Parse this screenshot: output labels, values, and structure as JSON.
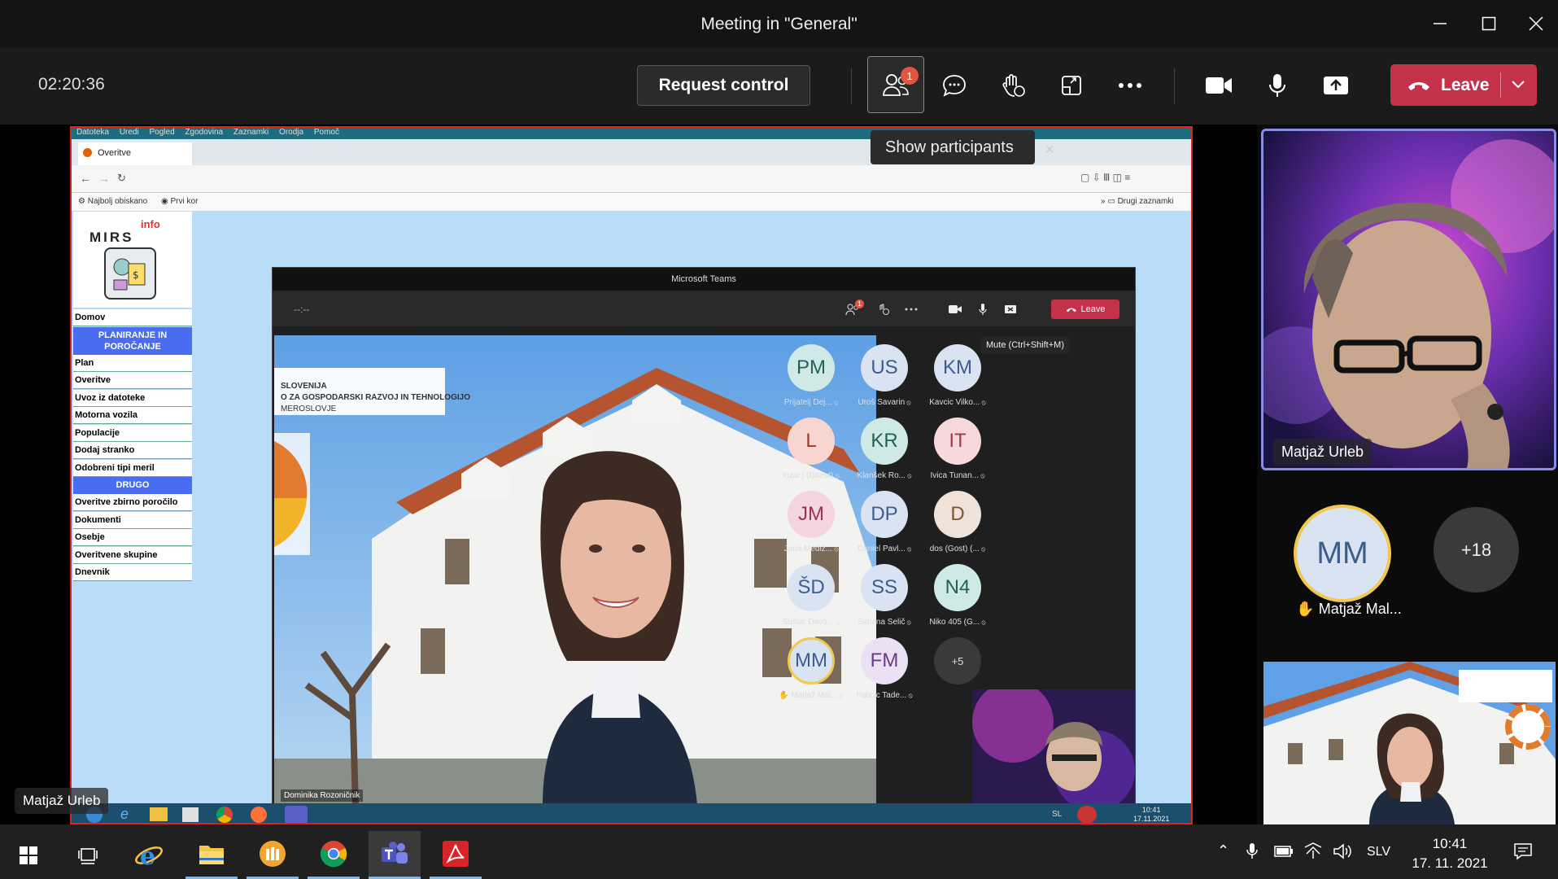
{
  "window": {
    "title": "Meeting in \"General\""
  },
  "toolbar": {
    "timer": "02:20:36",
    "request_control": "Request control",
    "participants_badge": "1",
    "leave_label": "Leave",
    "tooltip": "Show participants"
  },
  "shared_screen": {
    "remote_menu": [
      "Datoteka",
      "Uredi",
      "Pogled",
      "Zgodovina",
      "Zaznamki",
      "Orodja",
      "Pomoč"
    ],
    "browser_tab": "Overitve",
    "bookmarks": [
      "Najbolj obiskano",
      "Prvi kor",
      "Drugi zaznamki"
    ],
    "mirs": {
      "logo_text": "MIRS",
      "logo_info": "info",
      "items": [
        {
          "label": "Domov",
          "type": "item"
        },
        {
          "label": "PLANIRANJE IN POROČANJE",
          "type": "header"
        },
        {
          "label": "Plan",
          "type": "item"
        },
        {
          "label": "Overitve",
          "type": "item"
        },
        {
          "label": "Uvoz iz datoteke",
          "type": "item"
        },
        {
          "label": "Motorna vozila",
          "type": "item"
        },
        {
          "label": "Populacije",
          "type": "item"
        },
        {
          "label": "Dodaj stranko",
          "type": "item"
        },
        {
          "label": "Odobreni tipi meril",
          "type": "item"
        },
        {
          "label": "DRUGO",
          "type": "header"
        },
        {
          "label": "Overitve zbirno poročilo",
          "type": "item"
        },
        {
          "label": "Dokumenti",
          "type": "item"
        },
        {
          "label": "Osebje",
          "type": "item"
        },
        {
          "label": "Overitvene skupine",
          "type": "item"
        },
        {
          "label": "Dnevnik",
          "type": "item"
        }
      ]
    },
    "inner_teams": {
      "title": "Microsoft Teams",
      "timer": "--:--",
      "leave": "Leave",
      "mute_tooltip": "Mute (Ctrl+Shift+M)",
      "participants_badge": "1",
      "speaker_name": "Dominika Rozoničnik",
      "banner_lines": [
        "SLOVENIJA",
        "O ZA GOSPODARSKI RAZVOJ IN TEHNOLOGIJO",
        "MEROSLOVJE"
      ],
      "participants": [
        {
          "initials": "PM",
          "name": "Prijatelj Dej...",
          "bg": "#cfe9e6",
          "fg": "#22615b"
        },
        {
          "initials": "US",
          "name": "Uroš Savarin",
          "bg": "#d9e3f2",
          "fg": "#3c5d8e"
        },
        {
          "initials": "KM",
          "name": "Kavcic Vilko...",
          "bg": "#d9e3f2",
          "fg": "#3c5d8e"
        },
        {
          "initials": "L",
          "name": "lozar.j (Guest)",
          "bg": "#f7d6cf",
          "fg": "#9b3a2a"
        },
        {
          "initials": "KR",
          "name": "Klanšek Ro...",
          "bg": "#cfe9e6",
          "fg": "#22615b"
        },
        {
          "initials": "IT",
          "name": "Ivica Tunan...",
          "bg": "#f7d9dc",
          "fg": "#a33a48"
        },
        {
          "initials": "JM",
          "name": "Jana Mediž...",
          "bg": "#f5d5df",
          "fg": "#9b3159"
        },
        {
          "initials": "DP",
          "name": "Daniel Pavl...",
          "bg": "#d9e3f2",
          "fg": "#3c5d8e"
        },
        {
          "initials": "D",
          "name": "dos (Gost) (...",
          "bg": "#efe3d9",
          "fg": "#7a5531"
        },
        {
          "initials": "ŠD",
          "name": "Šuštar Davo...",
          "bg": "#d9e3f2",
          "fg": "#3c5d8e"
        },
        {
          "initials": "SS",
          "name": "Simona Selič",
          "bg": "#d9e3f2",
          "fg": "#3c5d8e"
        },
        {
          "initials": "N4",
          "name": "Niko 405 (G...",
          "bg": "#cfe9e6",
          "fg": "#22615b"
        },
        {
          "initials": "MM",
          "name": "Matjaž Mal...",
          "bg": "#d9e3f2",
          "fg": "#3c5d8e",
          "hand": true
        },
        {
          "initials": "FM",
          "name": "Fabcic Tade...",
          "bg": "#ece0f4",
          "fg": "#6a3b8a"
        },
        {
          "initials": "+5",
          "name": "",
          "bg": "#3a3a3a",
          "fg": "#ddd"
        }
      ]
    },
    "remote_taskbar": {
      "lang": "SL",
      "time": "10:41",
      "date": "17.11.2021"
    },
    "presenter_label": "Matjaž Urleb"
  },
  "right_column": {
    "video1_name": "Matjaž Urleb",
    "raised_initials": "MM",
    "raised_name": "Matjaž Mal...",
    "overflow_count": "+18"
  },
  "taskbar": {
    "lang": "SLV",
    "time": "10:41",
    "date": "17. 11. 2021"
  },
  "colors": {
    "leave": "#c4314b",
    "accent": "#6264a7",
    "raise_hand": "#f2c94c"
  }
}
